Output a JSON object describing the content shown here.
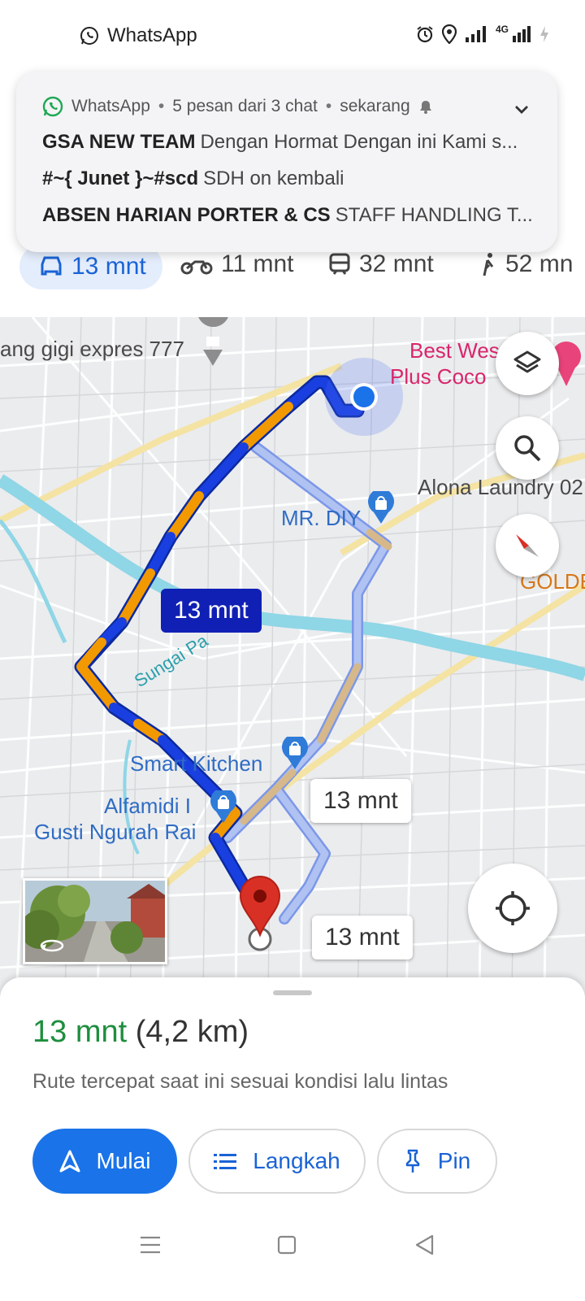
{
  "status_bar": {
    "app_name": "WhatsApp",
    "network": "4G"
  },
  "travel_modes": [
    {
      "label": "13 mnt",
      "icon": "car-icon"
    },
    {
      "label": "11 mnt",
      "icon": "motorcycle-icon"
    },
    {
      "label": "32 mnt",
      "icon": "transit-icon"
    },
    {
      "label": "52 mn",
      "icon": "walk-icon"
    }
  ],
  "notification": {
    "app": "WhatsApp",
    "summary": "5 pesan dari 3 chat",
    "time": "sekarang",
    "messages": [
      {
        "sender": "GSA NEW TEAM",
        "text": "Dengan Hormat  Dengan ini Kami s..."
      },
      {
        "sender": "#~{ Junet }~#scd",
        "text": "SDH on kembali"
      },
      {
        "sender": "ABSEN HARIAN PORTER & CS",
        "text": "STAFF HANDLING T..."
      }
    ]
  },
  "map": {
    "places": {
      "gigi": "ang gigi expres 777",
      "best_western_1": "Best Wes",
      "best_western_2": "Plus Coco",
      "alona": "Alona Laundry 02",
      "mrdiy": "MR. DIY",
      "golden": "GOLDE",
      "sungai": "Sungai Pa",
      "smart_kitchen": "Smart Kitchen",
      "alfamidi_1": "Alfamidi I",
      "alfamidi_2": "Gusti Ngurah Rai"
    },
    "route_labels": {
      "main": "13 mnt",
      "alt1": "13 mnt",
      "alt2": "13 mnt"
    },
    "colors": {
      "route_fast": "#1a3fe0",
      "route_slow": "#f29900",
      "route_alt": "#9fb4ee",
      "river": "#8fd6e6",
      "destination": "#d93025"
    }
  },
  "sheet": {
    "duration": "13 mnt",
    "distance": "(4,2 km)",
    "subtitle": "Rute tercepat saat ini sesuai kondisi lalu lintas",
    "buttons": {
      "start": "Mulai",
      "steps": "Langkah",
      "pin": "Pin"
    }
  }
}
